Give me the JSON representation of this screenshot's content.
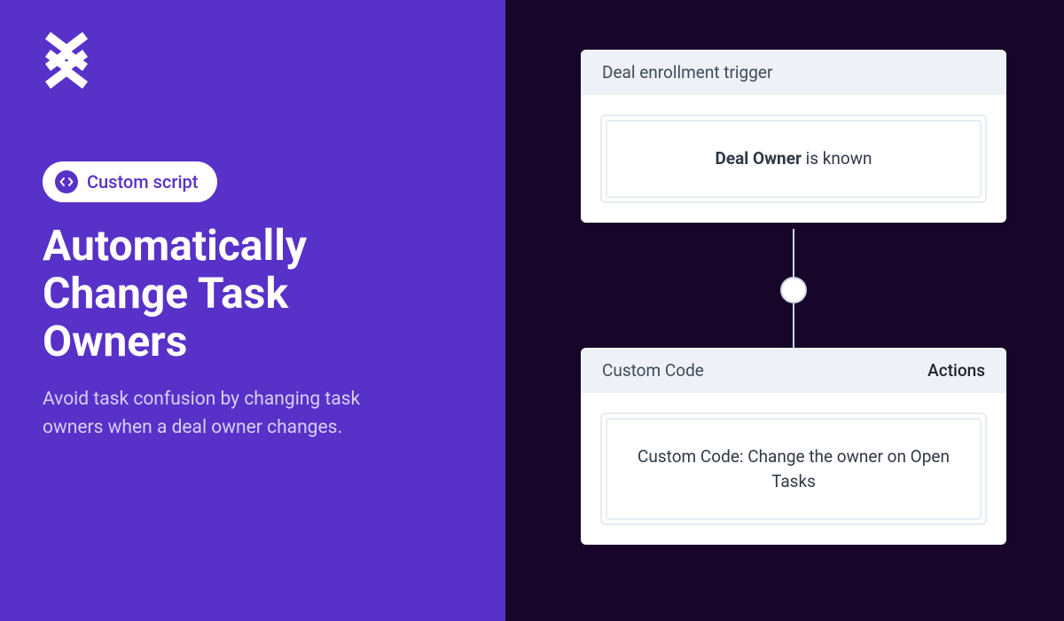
{
  "left": {
    "pill_label": "Custom script",
    "title": "Automatically Change Task Owners",
    "subtitle": "Avoid task confusion by changing task owners when a deal owner changes."
  },
  "flow": {
    "trigger": {
      "header": "Deal enrollment trigger",
      "condition_bold": "Deal Owner",
      "condition_rest": " is known"
    },
    "action": {
      "header": "Custom Code",
      "actions_label": "Actions",
      "body": "Custom Code: Change the owner on Open Tasks"
    }
  }
}
